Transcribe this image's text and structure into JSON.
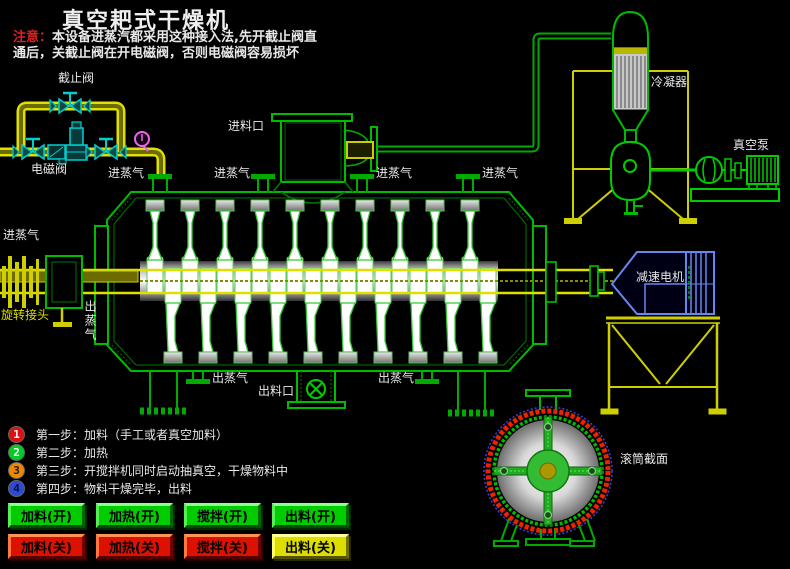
{
  "title": "真空耙式干燥机",
  "warning": {
    "prefix": "注意：",
    "line1": "本设备进蒸汽都采用这种接入法,先开截止阀直",
    "line2": "通后，关截止阀在开电磁阀，否则电磁阀容易损坏"
  },
  "schematic_labels": {
    "stop_valve": "截止阀",
    "solenoid_valve": "电磁阀",
    "steam_in": "进蒸气",
    "steam_out": "出蒸气",
    "feed_port": "进料口",
    "discharge_port": "出料口",
    "condenser": "冷凝器",
    "vacuum_pump": "真空泵",
    "gear_motor": "减速电机",
    "rotary_joint": "旋转接头",
    "drum_section": "滚筒截面"
  },
  "steps": [
    {
      "num": "1",
      "text": "第一步：加料（手工或者真空加料）",
      "badge_style": "background:#DD1111;color:#FFFFFF"
    },
    {
      "num": "2",
      "text": "第二步：加热",
      "badge_style": "background:#00CC22;color:#FFFFFF"
    },
    {
      "num": "3",
      "text": "第三步：开搅拌机同时启动抽真空，干燥物料中",
      "badge_style": "background:#EE8800;color:#1A1A1A"
    },
    {
      "num": "4",
      "text": "第四步：物料干燥完毕，出料",
      "badge_style": "background:#2B4BD0;color:#101035"
    }
  ],
  "buttons": {
    "on": [
      "加料(开)",
      "加热(开)",
      "搅拌(开)",
      "出料(开)"
    ],
    "off": [
      "加料(关)",
      "加热(关)",
      "搅拌(关)",
      "出料(关)"
    ]
  },
  "colors": {
    "background": "#000000",
    "machine_green": "#00BB00",
    "pipe_yellow": "#DFDF00",
    "valve_cyan": "#00CCCC",
    "gauge_magenta": "#EE66EE",
    "motor_blue": "#5577DD",
    "section_ring_red": "#EE2200",
    "button_on_green": "#00CC00",
    "button_off_red": "#DD1100",
    "button_discharge_off_yellow": "#DDDD00",
    "warning_red": "#D82222",
    "title_white": "#EFEFEF"
  }
}
